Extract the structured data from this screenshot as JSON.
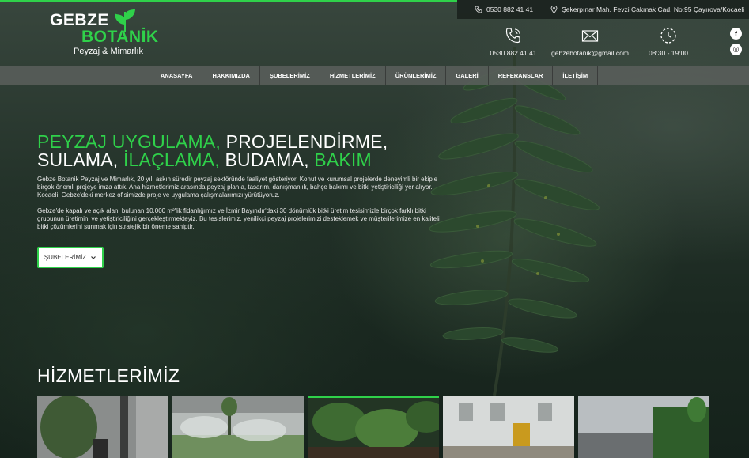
{
  "topbar": {
    "phone": "0530 882 41 41",
    "address": "Şekerpınar Mah. Fevzi Çakmak Cad. No:95 Çayırova/Kocaeli"
  },
  "logo": {
    "line1": "GEBZE",
    "line2": "BOTANİK",
    "subtitle": "Peyzaj & Mimarlık"
  },
  "contacts": {
    "phone": "0530 882 41 41",
    "email": "gebzebotanik@gmail.com",
    "hours": "08:30 - 19:00"
  },
  "social": [
    {
      "icon": "facebook-icon",
      "glyph": "f"
    },
    {
      "icon": "instagram-icon",
      "glyph": "◎"
    }
  ],
  "nav": [
    "ANASAYFA",
    "HAKKIMIZDA",
    "ŞUBELERİMİZ",
    "HİZMETLERİMİZ",
    "ÜRÜNLERİMİZ",
    "GALERİ",
    "REFERANSLAR",
    "İLETİŞİM"
  ],
  "hero": {
    "t1": "PEYZAJ UYGULAMA,",
    "t2": " PROJELENDİRME,",
    "t3": "SULAMA,",
    "t4": " İLAÇLAMA,",
    "t5": " BUDAMA,",
    "t6": " BAKIM",
    "p1": "Gebze Botanik Peyzaj ve Mimarlık, 20 yılı aşkın süredir peyzaj sektöründe faaliyet gösteriyor. Konut ve kurumsal projelerde deneyimli bir ekiple birçok önemli projeye imza attık. Ana hizmetlerimiz arasında peyzaj plan a, tasarım, danışmanlık, bahçe bakımı ve bitki yetiştiriciliği yer alıyor. Kocaeli, Gebze'deki merkez ofisimizde proje ve uygulama çalışmalarımızı yürütüyoruz.",
    "p2": "Gebze'de kapalı ve açık alanı bulunan 10.000 m²'lik fidanlığımız ve İzmir Bayındır'daki 30 dönümlük bitki üretim tesisimizle birçok farklı bitki grubunun üretimini ve yetiştiriciliğini gerçekleştirmekteyiz. Bu tesislerimiz, yenilikçi peyzaj projelerimizi desteklemek ve müşterilerimize en kaliteli bitki çözümlerini sunmak için stratejik bir öneme sahiptir.",
    "cta": "ŞUBELERİMİZ"
  },
  "services": {
    "title": "HİZMETLERİMİZ"
  },
  "colors": {
    "accent": "#2fd14a",
    "nav_bg": "#5a5f5c"
  }
}
